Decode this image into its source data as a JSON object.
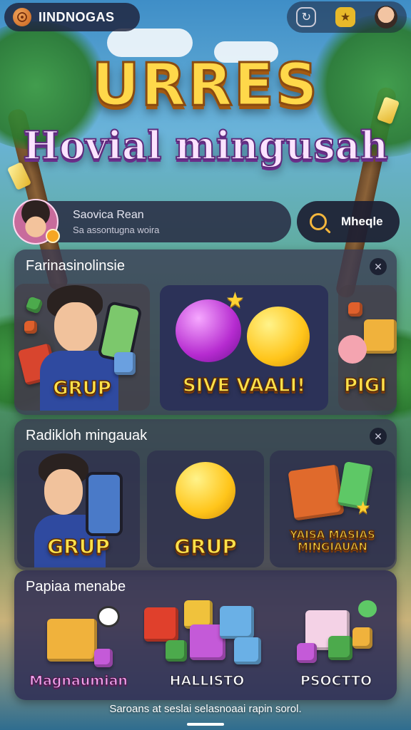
{
  "app": {
    "brand": "IINDNOGAS"
  },
  "top_icons": [
    "refresh-icon",
    "shield-badge-icon",
    "avatar-icon"
  ],
  "hero": {
    "title_line1": "URRES",
    "title_line2": "Hovial mingusah"
  },
  "profile": {
    "name": "Saovica Rean",
    "subtitle": "Sa assontugna woira"
  },
  "search": {
    "label": "Mheqle"
  },
  "section1": {
    "title": "Farinasinolinsie",
    "cards": [
      {
        "label": "GRUP"
      },
      {
        "label": "SIVE VAALI!"
      },
      {
        "label": "PIGI"
      }
    ]
  },
  "section2": {
    "title": "Radikloh mingauak",
    "cards": [
      {
        "label": "GRUP"
      },
      {
        "label": "GRUP"
      },
      {
        "label": "YAISA MASIAS MINGIAUAN"
      }
    ]
  },
  "section3": {
    "title": "Papiaa menabe",
    "cards": [
      {
        "label": "Magnaumian"
      },
      {
        "label": "HALLISTO"
      },
      {
        "label": "PSOCTTO"
      }
    ]
  },
  "footer": {
    "text": "Saroans at seslai selasnoaai rapin sorol."
  },
  "colors": {
    "accent_gold": "#ffd84a",
    "panel": "#3a3a52",
    "title_pink": "#fbe3ff"
  }
}
